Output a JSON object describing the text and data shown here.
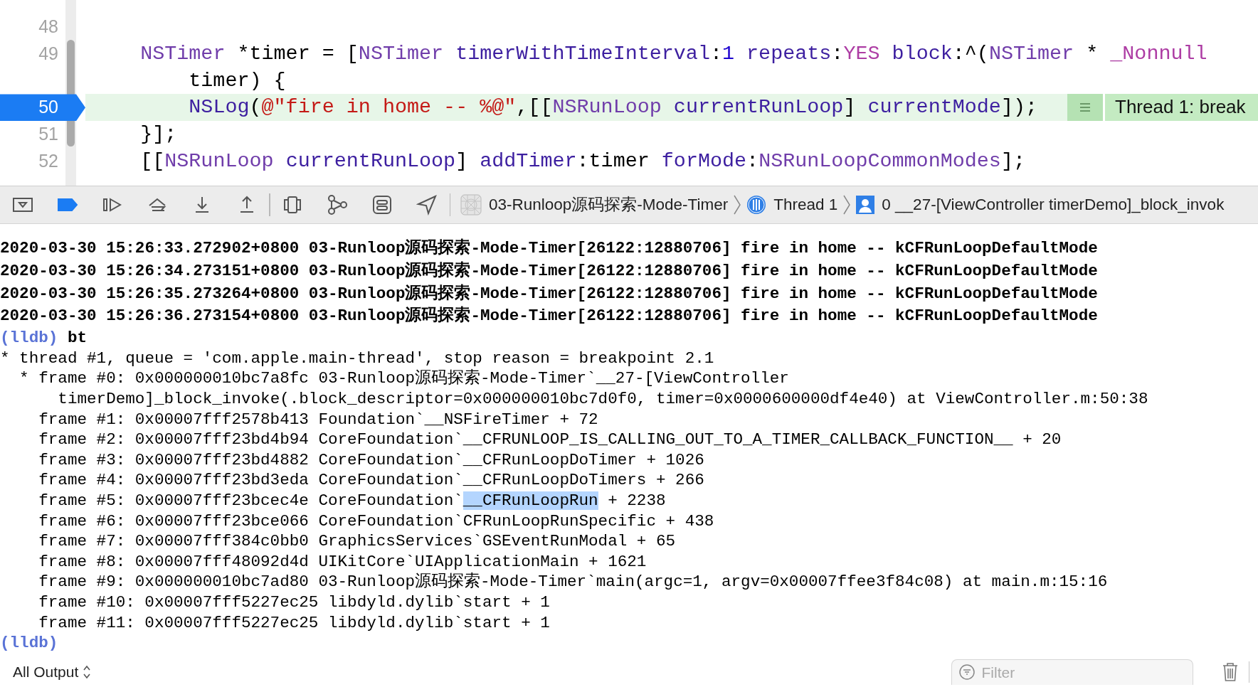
{
  "editor": {
    "lines": [
      {
        "number": "48",
        "current": false,
        "rows": [
          []
        ]
      },
      {
        "number": "49",
        "current": false,
        "rows": [
          [
            {
              "text": "    ",
              "kind": "plain"
            },
            {
              "text": "NSTimer",
              "kind": "class"
            },
            {
              "text": " *timer = [",
              "kind": "plain"
            },
            {
              "text": "NSTimer",
              "kind": "class"
            },
            {
              "text": " ",
              "kind": "plain"
            },
            {
              "text": "timerWithTimeInterval",
              "kind": "method"
            },
            {
              "text": ":",
              "kind": "plain"
            },
            {
              "text": "1",
              "kind": "number"
            },
            {
              "text": " ",
              "kind": "plain"
            },
            {
              "text": "repeats",
              "kind": "method"
            },
            {
              "text": ":",
              "kind": "plain"
            },
            {
              "text": "YES",
              "kind": "keyword"
            },
            {
              "text": " ",
              "kind": "plain"
            },
            {
              "text": "block",
              "kind": "method"
            },
            {
              "text": ":^(",
              "kind": "plain"
            },
            {
              "text": "NSTimer",
              "kind": "class"
            },
            {
              "text": " * ",
              "kind": "plain"
            },
            {
              "text": "_Nonnull",
              "kind": "keyword"
            }
          ],
          [
            {
              "text": "        timer) {",
              "kind": "plain"
            }
          ]
        ]
      },
      {
        "number": "50",
        "current": true,
        "rows": [
          [
            {
              "text": "        ",
              "kind": "plain"
            },
            {
              "text": "NSLog",
              "kind": "method"
            },
            {
              "text": "(",
              "kind": "plain"
            },
            {
              "text": "@\"fire in home -- %@\"",
              "kind": "string"
            },
            {
              "text": ",[[",
              "kind": "plain"
            },
            {
              "text": "NSRunLoop",
              "kind": "class"
            },
            {
              "text": " ",
              "kind": "plain"
            },
            {
              "text": "currentRunLoop",
              "kind": "method"
            },
            {
              "text": "] ",
              "kind": "plain"
            },
            {
              "text": "currentMode",
              "kind": "method"
            },
            {
              "text": "]);",
              "kind": "plain"
            }
          ]
        ],
        "annotation": "Thread 1: break"
      },
      {
        "number": "51",
        "current": false,
        "rows": [
          [
            {
              "text": "    }];",
              "kind": "plain"
            }
          ]
        ]
      },
      {
        "number": "52",
        "current": false,
        "rows": [
          [
            {
              "text": "    [[",
              "kind": "plain"
            },
            {
              "text": "NSRunLoop",
              "kind": "class"
            },
            {
              "text": " ",
              "kind": "plain"
            },
            {
              "text": "currentRunLoop",
              "kind": "method"
            },
            {
              "text": "] ",
              "kind": "plain"
            },
            {
              "text": "addTimer",
              "kind": "method"
            },
            {
              "text": ":timer ",
              "kind": "plain"
            },
            {
              "text": "forMode",
              "kind": "method"
            },
            {
              "text": ":",
              "kind": "plain"
            },
            {
              "text": "NSRunLoopCommonModes",
              "kind": "class"
            },
            {
              "text": "];",
              "kind": "plain"
            }
          ]
        ]
      }
    ]
  },
  "debug_bar": {
    "breakpoints_active": true,
    "breadcrumbs": [
      "03-Runloop源码探索-Mode-Timer",
      "Thread 1",
      "0 __27-[ViewController timerDemo]_block_invok"
    ]
  },
  "console": [
    {
      "kind": "log",
      "text": "2020-03-30 15:26:33.272902+0800 03-Runloop源码探索-Mode-Timer[26122:12880706] fire in home -- kCFRunLoopDefaultMode"
    },
    {
      "kind": "log",
      "text": "2020-03-30 15:26:34.273151+0800 03-Runloop源码探索-Mode-Timer[26122:12880706] fire in home -- kCFRunLoopDefaultMode"
    },
    {
      "kind": "log",
      "text": "2020-03-30 15:26:35.273264+0800 03-Runloop源码探索-Mode-Timer[26122:12880706] fire in home -- kCFRunLoopDefaultMode"
    },
    {
      "kind": "log",
      "text": "2020-03-30 15:26:36.273154+0800 03-Runloop源码探索-Mode-Timer[26122:12880706] fire in home -- kCFRunLoopDefaultMode"
    },
    {
      "kind": "prompt",
      "prompt": "(lldb)",
      "command": "bt"
    },
    {
      "kind": "thread",
      "text": "* thread #1, queue = 'com.apple.main-thread', stop reason = breakpoint 2.1",
      "frames": [
        {
          "current": true,
          "segments": [
            {
              "text": "* frame #0: 0x000000010bc7a8fc 03-Runloop源码探索-Mode-Timer`__27-[ViewController",
              "selected": false
            }
          ],
          "continuation": "timerDemo]_block_invoke(.block_descriptor=0x000000010bc7d0f0, timer=0x0000600000df4e40) at ViewController.m:50:38"
        },
        {
          "current": false,
          "segments": [
            {
              "text": "frame #1: 0x00007fff2578b413 Foundation`__NSFireTimer + 72",
              "selected": false
            }
          ]
        },
        {
          "current": false,
          "segments": [
            {
              "text": "frame #2: 0x00007fff23bd4b94 CoreFoundation`__CFRUNLOOP_IS_CALLING_OUT_TO_A_TIMER_CALLBACK_FUNCTION__ + 20",
              "selected": false
            }
          ]
        },
        {
          "current": false,
          "segments": [
            {
              "text": "frame #3: 0x00007fff23bd4882 CoreFoundation`__CFRunLoopDoTimer + 1026",
              "selected": false
            }
          ]
        },
        {
          "current": false,
          "segments": [
            {
              "text": "frame #4: 0x00007fff23bd3eda CoreFoundation`__CFRunLoopDoTimers + 266",
              "selected": false
            }
          ]
        },
        {
          "current": false,
          "segments": [
            {
              "text": "frame #5: 0x00007fff23bcec4e CoreFoundation`",
              "selected": false
            },
            {
              "text": "__CFRunLoopRun",
              "selected": true
            },
            {
              "text": " + 2238",
              "selected": false
            }
          ]
        },
        {
          "current": false,
          "segments": [
            {
              "text": "frame #6: 0x00007fff23bce066 CoreFoundation`CFRunLoopRunSpecific + 438",
              "selected": false
            }
          ]
        },
        {
          "current": false,
          "segments": [
            {
              "text": "frame #7: 0x00007fff384c0bb0 GraphicsServices`GSEventRunModal + 65",
              "selected": false
            }
          ]
        },
        {
          "current": false,
          "segments": [
            {
              "text": "frame #8: 0x00007fff48092d4d UIKitCore`UIApplicationMain + 1621",
              "selected": false
            }
          ]
        },
        {
          "current": false,
          "segments": [
            {
              "text": "frame #9: 0x000000010bc7ad80 03-Runloop源码探索-Mode-Timer`main(argc=1, argv=0x00007ffee3f84c08) at main.m:15:16",
              "selected": false
            }
          ]
        },
        {
          "current": false,
          "segments": [
            {
              "text": "frame #10: 0x00007fff5227ec25 libdyld.dylib`start + 1",
              "selected": false
            }
          ]
        },
        {
          "current": false,
          "segments": [
            {
              "text": "frame #11: 0x00007fff5227ec25 libdyld.dylib`start + 1",
              "selected": false
            }
          ]
        }
      ]
    },
    {
      "kind": "prompt",
      "prompt": "(lldb)"
    }
  ],
  "bottom_bar": {
    "output_menu": "All Output",
    "filter": {
      "placeholder": "Filter"
    }
  }
}
